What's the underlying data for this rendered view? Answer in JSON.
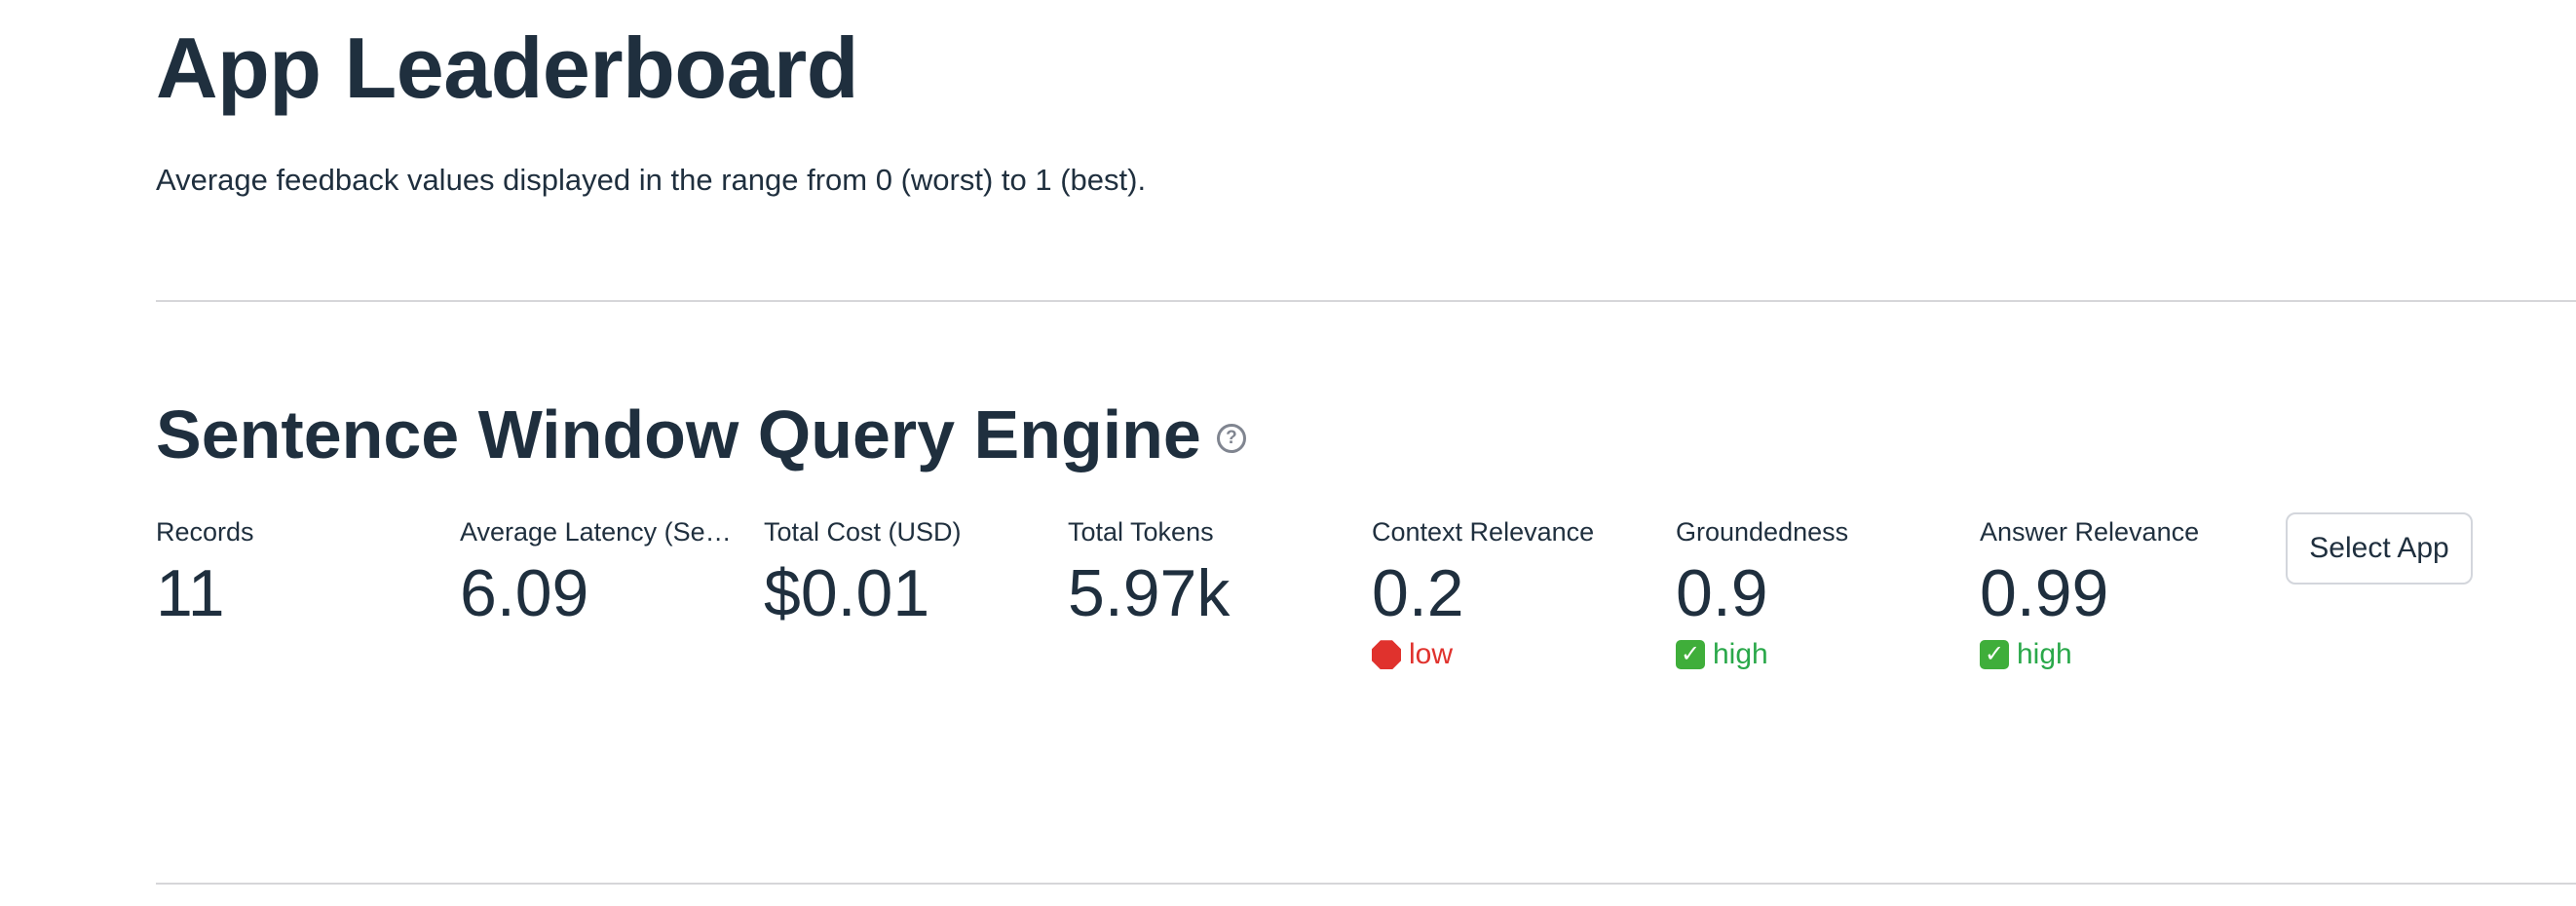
{
  "page": {
    "title": "App Leaderboard",
    "subtitle": "Average feedback values displayed in the range from 0 (worst) to 1 (best)."
  },
  "app": {
    "name": "Sentence Window Query Engine",
    "help_icon": "?",
    "select_button_label": "Select App",
    "metrics": [
      {
        "label": "Records",
        "value": "11"
      },
      {
        "label": "Average Latency (Sec…",
        "value": "6.09"
      },
      {
        "label": "Total Cost (USD)",
        "value": "$0.01"
      },
      {
        "label": "Total Tokens",
        "value": "5.97k"
      },
      {
        "label": "Context Relevance",
        "value": "0.2",
        "delta": "low",
        "delta_icon": "stop-sign-icon",
        "delta_color": "#e0322d"
      },
      {
        "label": "Groundedness",
        "value": "0.9",
        "delta": "high",
        "delta_icon": "check-mark-icon",
        "delta_color": "#2aa84a"
      },
      {
        "label": "Answer Relevance",
        "value": "0.99",
        "delta": "high",
        "delta_icon": "check-mark-icon",
        "delta_color": "#2aa84a"
      }
    ]
  },
  "colors": {
    "text": "#1f2f3e",
    "divider": "#d6d6d9",
    "low": "#e0322d",
    "high": "#2aa84a"
  }
}
